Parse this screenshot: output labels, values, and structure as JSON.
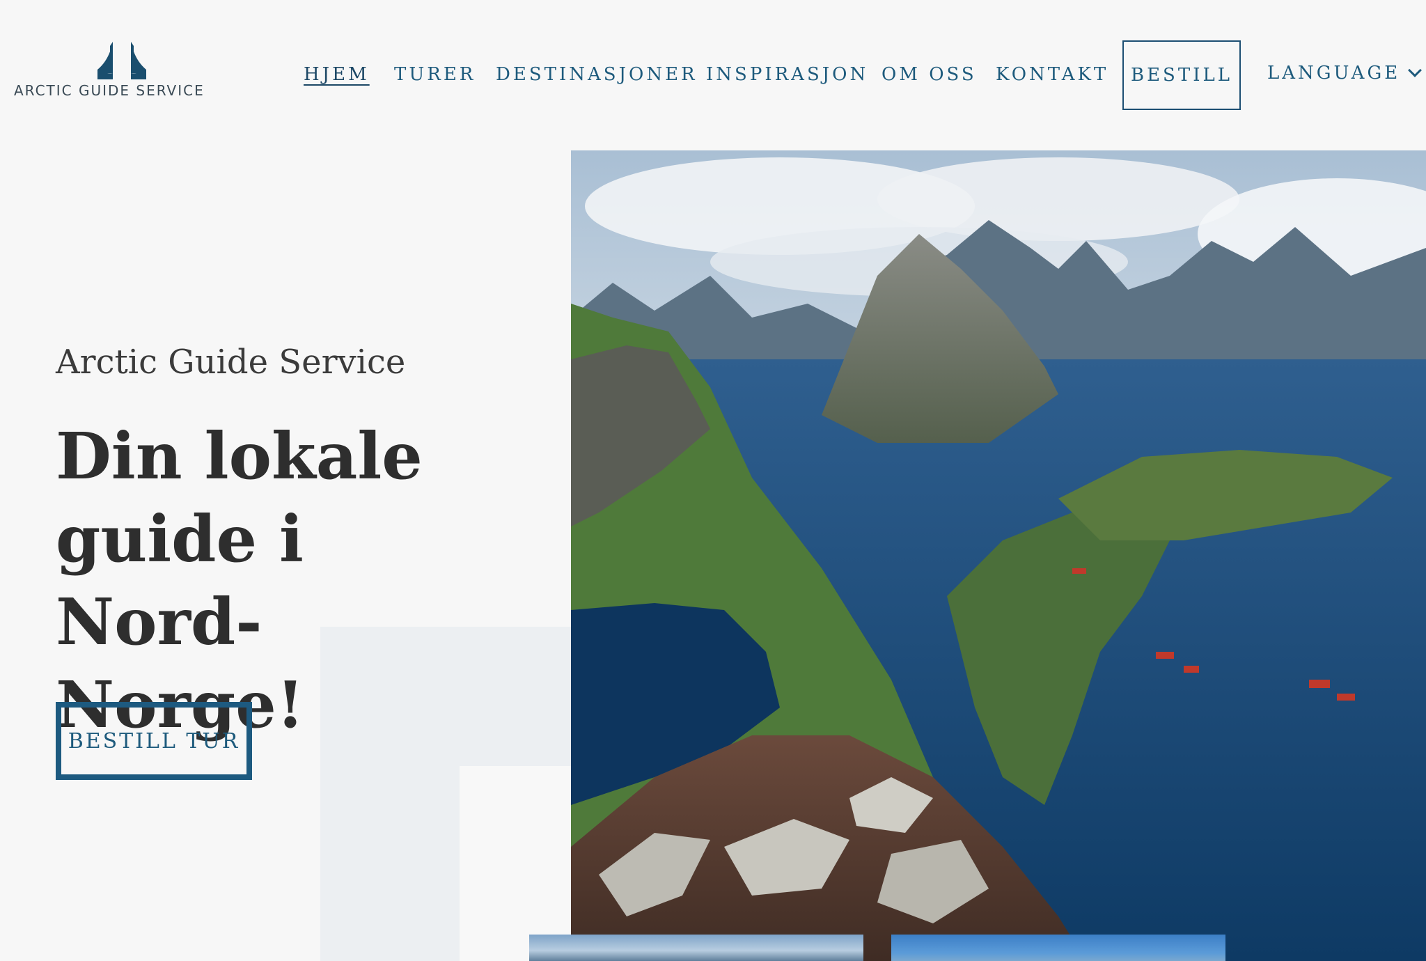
{
  "brand": {
    "logo_text": "ARCTIC GUIDE SERVICE"
  },
  "nav": {
    "items": [
      {
        "label": "HJEM",
        "active": true
      },
      {
        "label": "TURER",
        "active": false
      },
      {
        "label": "DESTINASJONER",
        "active": false
      },
      {
        "label": "INSPIRASJON",
        "active": false
      },
      {
        "label": "OM OSS",
        "active": false
      },
      {
        "label": "KONTAKT",
        "active": false
      }
    ],
    "bestill_label": "BESTILL",
    "language_label": "LANGUAGE",
    "language_icon": "chevron-down-icon"
  },
  "hero": {
    "subtitle": "Arctic Guide Service",
    "title": "Din lokale guide i Nord-Norge!",
    "cta_label": "BESTILL TUR",
    "image_alt": "Fjord and mountain landscape"
  },
  "colors": {
    "accent": "#1d5a7c",
    "background": "#f7f7f7",
    "text": "#2e2e2e",
    "deco": "#eceff2"
  }
}
